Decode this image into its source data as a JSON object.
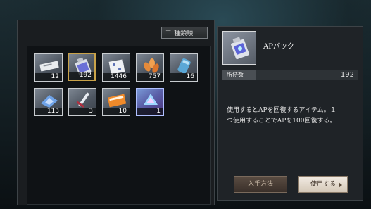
{
  "toolbar": {
    "sort_label": "種類順"
  },
  "inventory": {
    "items": [
      {
        "name": "ticket",
        "count": "12"
      },
      {
        "name": "ap-pack",
        "count": "192",
        "selected": true
      },
      {
        "name": "dice-box",
        "count": "1446"
      },
      {
        "name": "leaves",
        "count": "757"
      },
      {
        "name": "canister",
        "count": "16"
      },
      {
        "name": "crystal-book",
        "count": "113"
      },
      {
        "name": "sword",
        "count": "3"
      },
      {
        "name": "orange-card",
        "count": "10"
      },
      {
        "name": "rainbow-chip",
        "count": "1"
      }
    ]
  },
  "detail": {
    "name": "APパック",
    "owned_label": "所持数",
    "owned_value": "192",
    "description_line1": "使用するとAPを回復するアイテム。１",
    "description_line2": "つ使用することでAPを100回復する。"
  },
  "buttons": {
    "obtain": "入手方法",
    "use": "使用する"
  },
  "colors": {
    "selected_border": "#c9a34a",
    "use_button": "#e6ddd2",
    "obtain_button": "#4a3e36"
  }
}
